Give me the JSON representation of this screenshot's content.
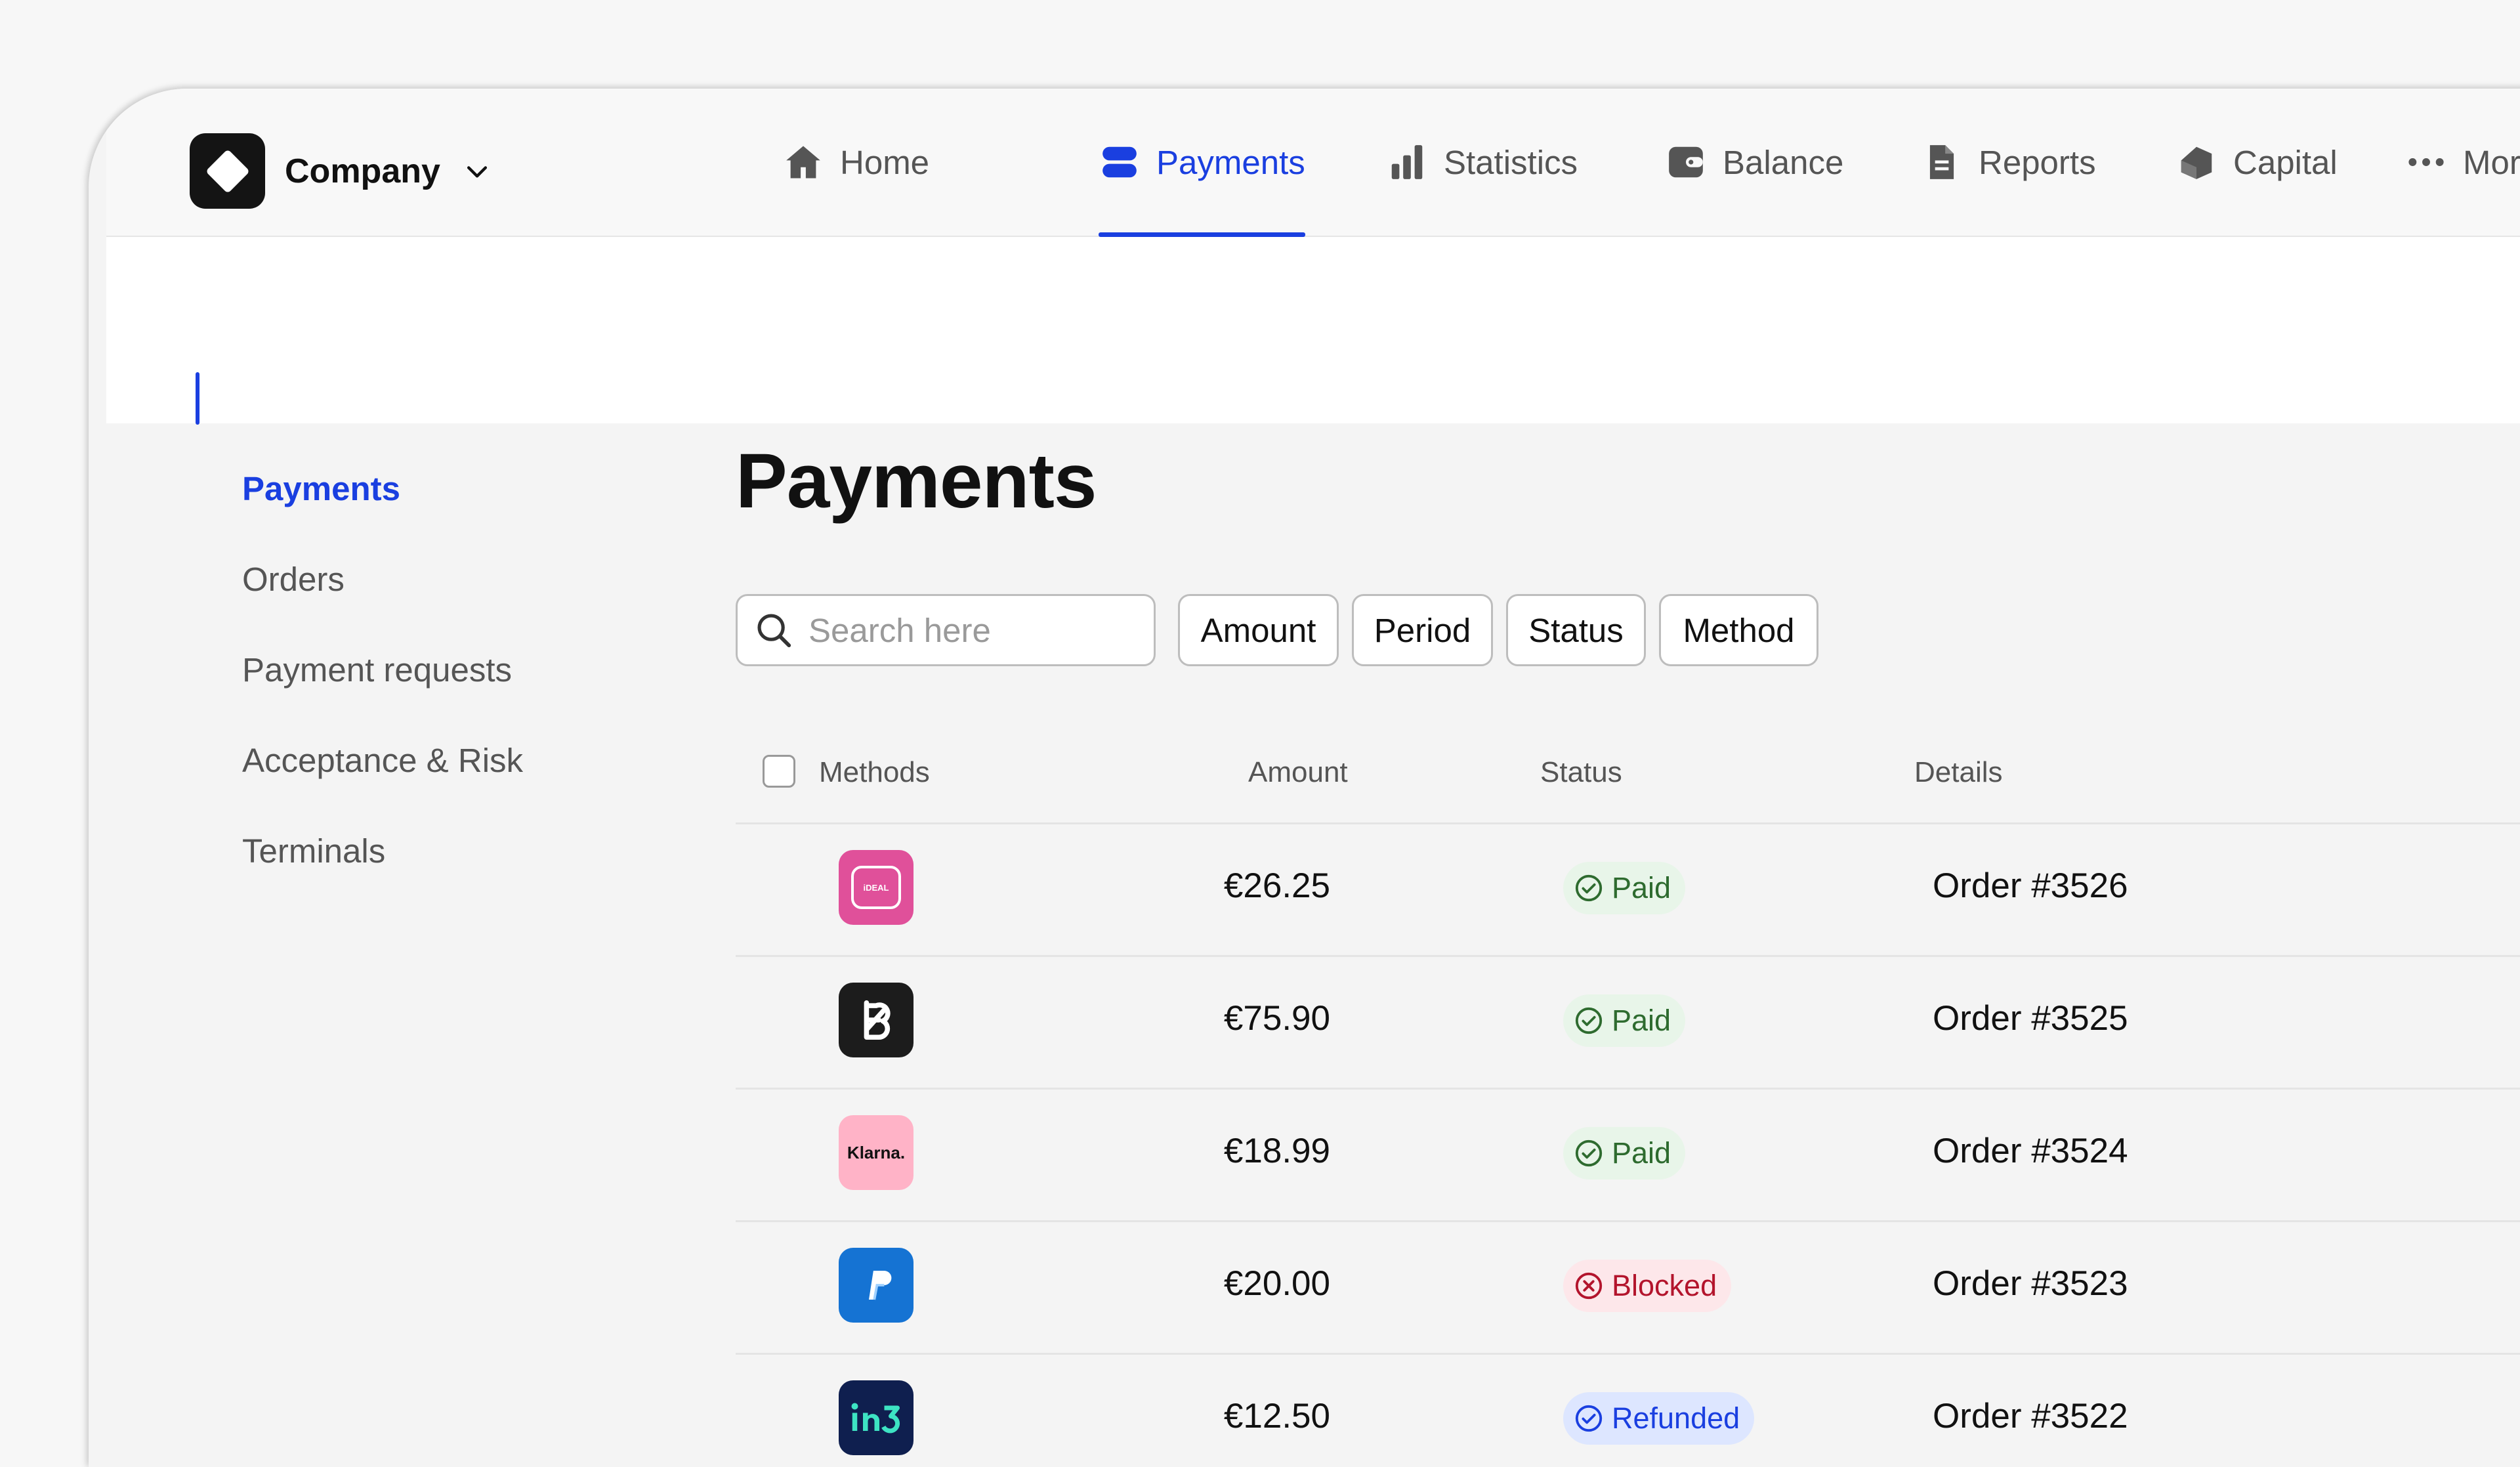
{
  "brand": {
    "name": "Company"
  },
  "nav": [
    {
      "label": "Home",
      "icon": "home-icon",
      "active": false
    },
    {
      "label": "Payments",
      "icon": "payments-icon",
      "active": true
    },
    {
      "label": "Statistics",
      "icon": "statistics-icon",
      "active": false
    },
    {
      "label": "Balance",
      "icon": "wallet-icon",
      "active": false
    },
    {
      "label": "Reports",
      "icon": "document-icon",
      "active": false
    },
    {
      "label": "Capital",
      "icon": "capital-icon",
      "active": false
    },
    {
      "label": "More",
      "icon": "more-icon",
      "active": false
    }
  ],
  "sidebar": {
    "items": [
      {
        "label": "Payments",
        "active": true
      },
      {
        "label": "Orders"
      },
      {
        "label": "Payment requests"
      },
      {
        "label": "Acceptance & Risk"
      },
      {
        "label": "Terminals"
      }
    ]
  },
  "page": {
    "title": "Payments"
  },
  "search": {
    "placeholder": "Search here",
    "value": ""
  },
  "filters": [
    "Amount",
    "Period",
    "Status",
    "Method"
  ],
  "table": {
    "headers": {
      "methods": "Methods",
      "amount": "Amount",
      "status": "Status",
      "details": "Details"
    },
    "rows": [
      {
        "method": "iDEAL",
        "amount": "€26.25",
        "status": "Paid",
        "details": "Order #3526"
      },
      {
        "method": "Billie",
        "amount": "€75.90",
        "status": "Paid",
        "details": "Order #3525"
      },
      {
        "method": "Klarna",
        "amount": "€18.99",
        "status": "Paid",
        "details": "Order #3524"
      },
      {
        "method": "PayPal",
        "amount": "€20.00",
        "status": "Blocked",
        "details": "Order #3523"
      },
      {
        "method": "in3",
        "amount": "€12.50",
        "status": "Refunded",
        "details": "Order #3522"
      }
    ]
  },
  "colors": {
    "accent": "#1a3fe0",
    "paid": "#2e6b2f",
    "blocked": "#b3142c",
    "refunded": "#1a3fe0"
  },
  "method_logos": {
    "ideal_text": "iDEAL",
    "klarna_text": "Klarna."
  }
}
